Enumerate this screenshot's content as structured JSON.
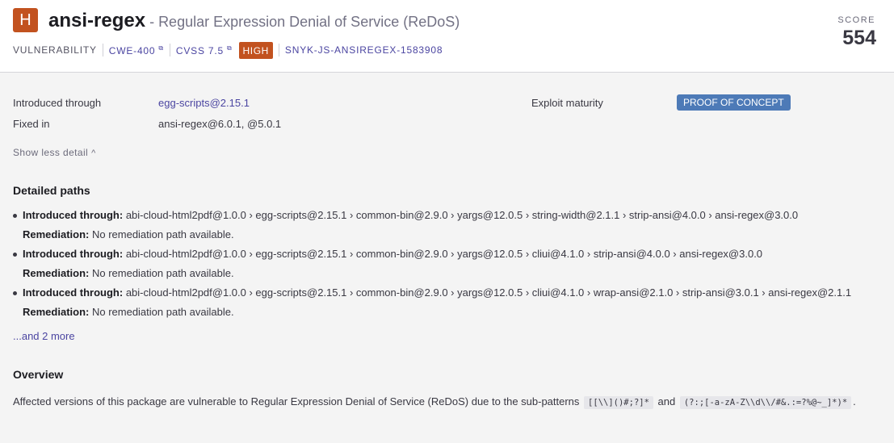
{
  "header": {
    "severity_letter": "H",
    "package_name": "ansi-regex",
    "title_separator": " - ",
    "vuln_title": "Regular Expression Denial of Service (ReDoS)",
    "type_label": "VULNERABILITY",
    "cwe": "CWE-400",
    "cvss": "CVSS 7.5",
    "severity_badge": "HIGH",
    "snyk_id": "SNYK-JS-ANSIREGEX-1583908",
    "score_label": "SCORE",
    "score_value": "554",
    "severity_color": "#c2521f"
  },
  "details": {
    "introduced_through_label": "Introduced through",
    "introduced_through_value": "egg-scripts@2.15.1",
    "fixed_in_label": "Fixed in",
    "fixed_in_value": "ansi-regex@6.0.1, @5.0.1",
    "exploit_maturity_label": "Exploit maturity",
    "exploit_maturity_value": "PROOF OF CONCEPT",
    "show_less": "Show less detail",
    "chevron_icon": "chevron-up-icon"
  },
  "paths": {
    "heading": "Detailed paths",
    "intro_label": "Introduced through:",
    "remediation_label": "Remediation:",
    "items": [
      {
        "path": "abi-cloud-html2pdf@1.0.0 › egg-scripts@2.15.1 › common-bin@2.9.0 › yargs@12.0.5 › string-width@2.1.1 › strip-ansi@4.0.0 › ansi-regex@3.0.0",
        "remediation": "No remediation path available."
      },
      {
        "path": "abi-cloud-html2pdf@1.0.0 › egg-scripts@2.15.1 › common-bin@2.9.0 › yargs@12.0.5 › cliui@4.1.0 › strip-ansi@4.0.0 › ansi-regex@3.0.0",
        "remediation": "No remediation path available."
      },
      {
        "path": "abi-cloud-html2pdf@1.0.0 › egg-scripts@2.15.1 › common-bin@2.9.0 › yargs@12.0.5 › cliui@4.1.0 › wrap-ansi@2.1.0 › strip-ansi@3.0.1 › ansi-regex@2.1.1",
        "remediation": "No remediation path available."
      }
    ],
    "more_link": "...and 2 more"
  },
  "overview": {
    "heading": "Overview",
    "text_before": "Affected versions of this package are vulnerable to Regular Expression Denial of Service (ReDoS) due to the sub-patterns",
    "code1": "[[\\\\]()#;?]*",
    "text_and": "and",
    "code2": "(?:;[-a-zA-Z\\\\d\\\\/#&.:=?%@~_]*)*",
    "text_end": "."
  }
}
